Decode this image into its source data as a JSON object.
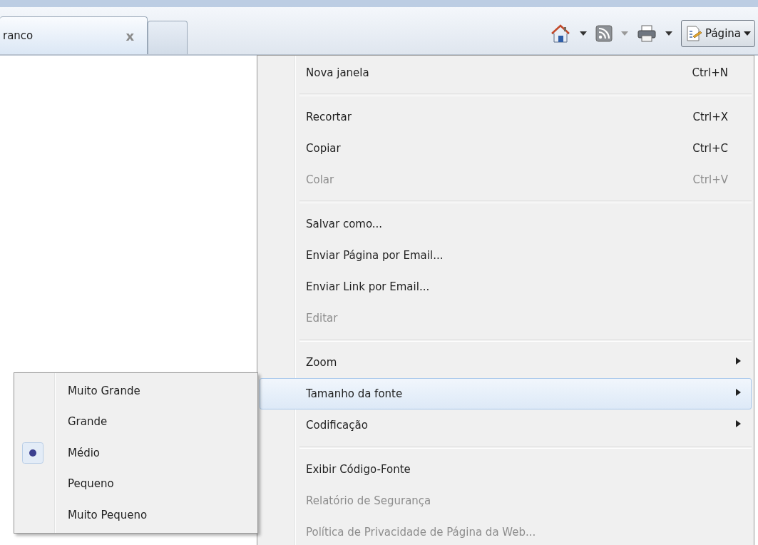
{
  "tabs": [
    {
      "label": "ranco",
      "close": "x",
      "selected": true
    },
    {
      "selected": false
    }
  ],
  "toolbar": {
    "page_button": "Página"
  },
  "menu": {
    "items": [
      {
        "kind": "item",
        "label": "Nova janela",
        "shortcut": "Ctrl+N",
        "disabled": false,
        "submenu": false,
        "selected": false
      },
      {
        "kind": "separator"
      },
      {
        "kind": "item",
        "label": "Recortar",
        "shortcut": "Ctrl+X",
        "disabled": false,
        "submenu": false,
        "selected": false
      },
      {
        "kind": "item",
        "label": "Copiar",
        "shortcut": "Ctrl+C",
        "disabled": false,
        "submenu": false,
        "selected": false
      },
      {
        "kind": "item",
        "label": "Colar",
        "shortcut": "Ctrl+V",
        "disabled": true,
        "submenu": false,
        "selected": false
      },
      {
        "kind": "separator"
      },
      {
        "kind": "item",
        "label": "Salvar como...",
        "disabled": false,
        "submenu": false,
        "selected": false
      },
      {
        "kind": "item",
        "label": "Enviar Página por Email...",
        "disabled": false,
        "submenu": false,
        "selected": false
      },
      {
        "kind": "item",
        "label": "Enviar Link por Email...",
        "disabled": false,
        "submenu": false,
        "selected": false
      },
      {
        "kind": "item",
        "label": "Editar",
        "disabled": true,
        "submenu": false,
        "selected": false
      },
      {
        "kind": "separator"
      },
      {
        "kind": "item",
        "label": "Zoom",
        "disabled": false,
        "submenu": true,
        "selected": false
      },
      {
        "kind": "item",
        "label": "Tamanho da fonte",
        "disabled": false,
        "submenu": true,
        "selected": true
      },
      {
        "kind": "item",
        "label": "Codificação",
        "disabled": false,
        "submenu": true,
        "selected": false
      },
      {
        "kind": "separator"
      },
      {
        "kind": "item",
        "label": "Exibir Código-Fonte",
        "disabled": false,
        "submenu": false,
        "selected": false
      },
      {
        "kind": "item",
        "label": "Relatório de Segurança",
        "disabled": true,
        "submenu": false,
        "selected": false
      },
      {
        "kind": "item",
        "label": "Política de Privacidade de Página da Web...",
        "disabled": true,
        "submenu": false,
        "selected": false
      }
    ]
  },
  "submenu": {
    "items": [
      {
        "label": "Muito Grande",
        "selected": false
      },
      {
        "label": "Grande",
        "selected": false
      },
      {
        "label": "Médio",
        "selected": true
      },
      {
        "label": "Pequeno",
        "selected": false
      },
      {
        "label": "Muito Pequeno",
        "selected": false
      }
    ]
  }
}
